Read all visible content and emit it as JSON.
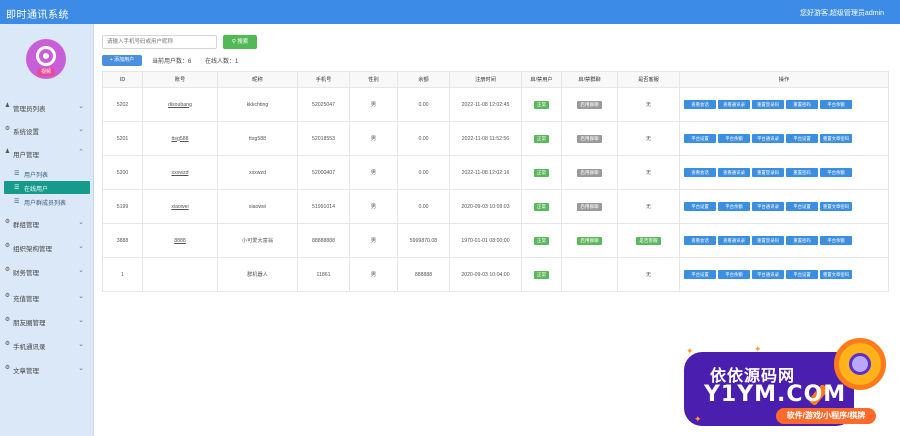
{
  "app": {
    "title": "即时通讯系统",
    "user": "您好游客,超级管理员admin"
  },
  "logo": {
    "tag": "视频"
  },
  "sidebar": {
    "items": [
      {
        "icon": "user-icon",
        "label": "管理员列表"
      },
      {
        "icon": "gear-icon",
        "label": "系统设置"
      },
      {
        "icon": "user-icon",
        "label": "用户管理"
      },
      {
        "icon": "gear-icon",
        "label": "群组管理"
      },
      {
        "icon": "gear-icon",
        "label": "组织架构管理"
      },
      {
        "icon": "gear-icon",
        "label": "财务管理"
      },
      {
        "icon": "gear-icon",
        "label": "充值管理"
      },
      {
        "icon": "gear-icon",
        "label": "朋友圈管理"
      },
      {
        "icon": "gear-icon",
        "label": "手机通讯录"
      },
      {
        "icon": "gear-icon",
        "label": "文章管理"
      }
    ],
    "subitems": [
      {
        "label": "用户列表"
      },
      {
        "label": "在线用户"
      },
      {
        "label": "用户群成员列表"
      }
    ]
  },
  "toolbar": {
    "search_placeholder": "请输入手机号码或用户昵称",
    "search_label": "搜索",
    "add_label": "+ 添加用户",
    "count_label": "当前用户数：6",
    "online_label": "在线人数：1"
  },
  "table": {
    "headers": [
      "ID",
      "账号",
      "昵称",
      "手机号",
      "性别",
      "余额",
      "注册时间",
      "启/禁用户",
      "启/禁群聊",
      "是否客服",
      "操作"
    ],
    "rows": [
      {
        "id": "5202",
        "account": "disoubang",
        "nick": "kkkchting",
        "phone": "52025047",
        "sex": "男",
        "balance": "0.00",
        "time": "2022-11-08 12:02:45",
        "status": "正常",
        "group": "启用群聊",
        "service": "无",
        "ops": [
          "查看会话",
          "查看通讯录",
          "重置登录码",
          "重置密码",
          "平台余额"
        ]
      },
      {
        "id": "5201",
        "account": "ttsg588",
        "nick": "ttsg588",
        "phone": "52018553",
        "sex": "男",
        "balance": "0.00",
        "time": "2022-11-08 11:52:56",
        "status": "正常",
        "group": "启用群聊",
        "service": "无",
        "ops": [
          "平台设置",
          "平台余额",
          "平台通讯录",
          "平台设置",
          "重置文章密码"
        ]
      },
      {
        "id": "5200",
        "account": "xxxwzd",
        "nick": "xxxwzd",
        "phone": "52000407",
        "sex": "男",
        "balance": "0.00",
        "time": "2022-11-08 12:02:16",
        "status": "正常",
        "group": "启用群聊",
        "service": "无",
        "ops": [
          "查看会话",
          "查看通讯录",
          "重置登录码",
          "重置密码",
          "平台余额"
        ]
      },
      {
        "id": "5199",
        "account": "xiaowei",
        "nick": "xiaowei",
        "phone": "51991014",
        "sex": "男",
        "balance": "0.00",
        "time": "2020-09-03 10:09:03",
        "status": "正常",
        "group": "启用群聊",
        "service": "无",
        "ops": [
          "平台设置",
          "平台余额",
          "平台通讯录",
          "平台设置",
          "重置文章密码"
        ]
      },
      {
        "id": "3888",
        "account": "8888",
        "nick": "小可爱大富翁",
        "phone": "88888888",
        "sex": "男",
        "balance": "5999870.08",
        "time": "1970-01-01 08:00:00",
        "status": "正常",
        "group": "启用群聊",
        "service": "是否客服",
        "ops": [
          "查看会话",
          "查看通讯录",
          "重置登录码",
          "重置密码",
          "平台余额"
        ]
      },
      {
        "id": "1",
        "account": "",
        "nick": "群机器人",
        "phone": "11861",
        "sex": "男",
        "balance": "888888",
        "time": "2020-09-03 10:04:00",
        "status": "正常",
        "group": "",
        "service": "无",
        "ops": [
          "平台设置",
          "平台余额",
          "平台通讯录",
          "平台设置",
          "重置文章密码"
        ]
      }
    ]
  },
  "watermark": {
    "line1": "依依源码网",
    "line2": "Y1YM.COM",
    "line3": "软件/游戏/小程序/棋牌"
  },
  "colors": {
    "topbar": "#3c8be6",
    "sidebar": "#dbe8f7",
    "active": "#159a8c",
    "action": "#3b8ee0",
    "search": "#53b856"
  }
}
